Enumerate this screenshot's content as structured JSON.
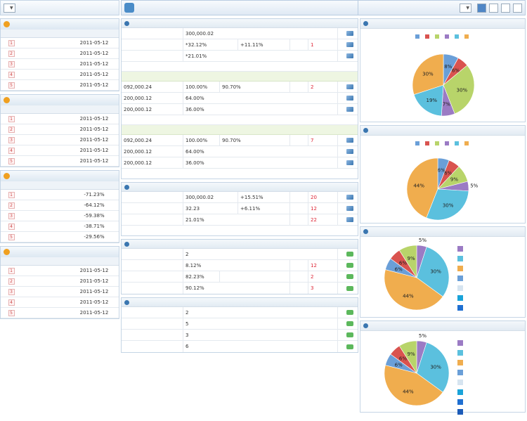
{
  "dept": {
    "label": "",
    "value": ""
  },
  "left_panels": [
    {
      "title": "",
      "more": "",
      "cols": [
        "",
        "",
        ""
      ],
      "rows": [
        [
          "1",
          "",
          "2011-05-12"
        ],
        [
          "2",
          "",
          "2011-05-12"
        ],
        [
          "3",
          "",
          "2011-05-12"
        ],
        [
          "4",
          "",
          "2011-05-12"
        ],
        [
          "5",
          "",
          "2011-05-12"
        ]
      ]
    },
    {
      "title": "",
      "more": "",
      "cols": [
        "",
        "",
        ""
      ],
      "rows": [
        [
          "1",
          "",
          "2011-05-12"
        ],
        [
          "2",
          "",
          "2011-05-12"
        ],
        [
          "3",
          "",
          "2011-05-12"
        ],
        [
          "4",
          "",
          "2011-05-12"
        ],
        [
          "5",
          "",
          "2011-05-12"
        ]
      ]
    },
    {
      "title": "",
      "more": "",
      "cols": [
        "",
        "",
        ""
      ],
      "rows": [
        [
          "1",
          "",
          "-71.23%"
        ],
        [
          "2",
          "",
          "-64.12%"
        ],
        [
          "3",
          "",
          "-59.38%"
        ],
        [
          "4",
          "",
          "-38.71%"
        ],
        [
          "5",
          "",
          "-29.56%"
        ]
      ]
    },
    {
      "title": "",
      "more": "",
      "cols": [
        "",
        "",
        ""
      ],
      "rows": [
        [
          "1",
          "",
          "2011-05-12"
        ],
        [
          "2",
          "",
          "2011-05-12"
        ],
        [
          "3",
          "",
          "2011-05-12"
        ],
        [
          "4",
          "",
          "2011-05-12"
        ],
        [
          "5",
          "",
          "2011-05-12"
        ]
      ]
    }
  ],
  "left_footnote": "",
  "main": {
    "title": "",
    "time_label": "",
    "time_value": "",
    "period_label": "",
    "periods": [
      "",
      "",
      "",
      ""
    ],
    "core": {
      "title": "",
      "r1": {
        "a": "",
        "b": "300,000.02",
        "icon": "chart-icon"
      },
      "r2": {
        "a": "",
        "b": "*32.12%",
        "c": "+11.11%",
        "d": "",
        "e": "1"
      },
      "r3": {
        "a": "",
        "b": "*21.01%"
      },
      "note1": "",
      "sub1": "",
      "s1r1": {
        "a": "092,000.24",
        "b": "100.00%",
        "c": "90.70%",
        "d": "",
        "e": "2"
      },
      "s1r2": {
        "a": "200,000.12",
        "b": "64.00%"
      },
      "s1r3": {
        "a": "200,000.12",
        "b": "36.00%"
      },
      "note2": "",
      "sub2": "",
      "s2r1": {
        "a": "092,000.24",
        "b": "100.00%",
        "c": "90.70%",
        "d": "",
        "e": "7"
      },
      "s2r2": {
        "a": "200,000.12",
        "b": "64.00%"
      },
      "s2r3": {
        "a": "200,000.12",
        "b": "36.00%"
      },
      "note3": ""
    },
    "aux": {
      "title": "",
      "r1": {
        "a": "",
        "b": "300,000.02",
        "c": "+15.51%",
        "d": "",
        "e": "20"
      },
      "r2": {
        "a": "",
        "b": "32.23",
        "c": "+6.11%",
        "d": "",
        "e": "12"
      },
      "r3": {
        "a": "",
        "b": "21.01%",
        "d": "",
        "e": "22"
      },
      "note": ""
    },
    "visit": {
      "title": "",
      "r1": {
        "a": "",
        "b": "2"
      },
      "r2": {
        "a": "",
        "b": "8.12%",
        "d": "",
        "e": "12"
      },
      "r3": {
        "a": "",
        "b": "82.23%",
        "c": "",
        "d": "",
        "e": "2"
      },
      "r4": {
        "a": "",
        "b": "90.12%",
        "d": "",
        "e": "3"
      }
    },
    "media": {
      "title": "",
      "r1": {
        "a": "",
        "b": "2"
      },
      "r2": {
        "a": "",
        "b": "5"
      },
      "r3": {
        "a": "",
        "b": "3"
      },
      "r4": {
        "a": "",
        "b": "6"
      }
    }
  },
  "chart_data": [
    {
      "type": "pie",
      "title": "",
      "legend": [
        "",
        "",
        "",
        "",
        "",
        ""
      ],
      "colors": [
        "#6a9fd8",
        "#d9534f",
        "#b8d46a",
        "#9b7bc4",
        "#5bc0de",
        "#f0ad4e"
      ],
      "values": [
        8,
        6,
        30,
        7,
        19,
        30
      ]
    },
    {
      "type": "pie",
      "title": "",
      "legend": [
        "",
        "",
        "",
        "",
        "",
        ""
      ],
      "colors": [
        "#6a9fd8",
        "#d9534f",
        "#b8d46a",
        "#9b7bc4",
        "#5bc0de",
        "#f0ad4e"
      ],
      "values": [
        6,
        6,
        9,
        5,
        30,
        44
      ]
    },
    {
      "type": "pie",
      "title": "",
      "legend": [
        "",
        "",
        "",
        "",
        "",
        "",
        ""
      ],
      "colors": [
        "#9b7bc4",
        "#5bc0de",
        "#f0ad4e",
        "#6a9fd8",
        "#d6e4f0",
        "#1aa3d9",
        "#1f6fd1"
      ],
      "values": [
        5,
        30,
        44,
        6,
        0,
        6,
        9
      ],
      "slice_colors": [
        "#9b7bc4",
        "#5bc0de",
        "#f0ad4e",
        "#6a9fd8",
        "#d9534f",
        "#b8d46a"
      ],
      "slice_values": [
        5,
        30,
        44,
        6,
        6,
        9
      ]
    },
    {
      "type": "pie",
      "title": "",
      "legend": [
        "",
        "",
        "",
        "",
        "",
        "",
        "",
        ""
      ],
      "colors": [
        "#9b7bc4",
        "#5bc0de",
        "#f0ad4e",
        "#6a9fd8",
        "#d6e4f0",
        "#1aa3d9",
        "#1f6fd1",
        "#1c5bb8"
      ],
      "slice_colors": [
        "#9b7bc4",
        "#5bc0de",
        "#f0ad4e",
        "#6a9fd8",
        "#d9534f",
        "#b8d46a"
      ],
      "slice_values": [
        5,
        30,
        44,
        6,
        6,
        9
      ]
    }
  ]
}
